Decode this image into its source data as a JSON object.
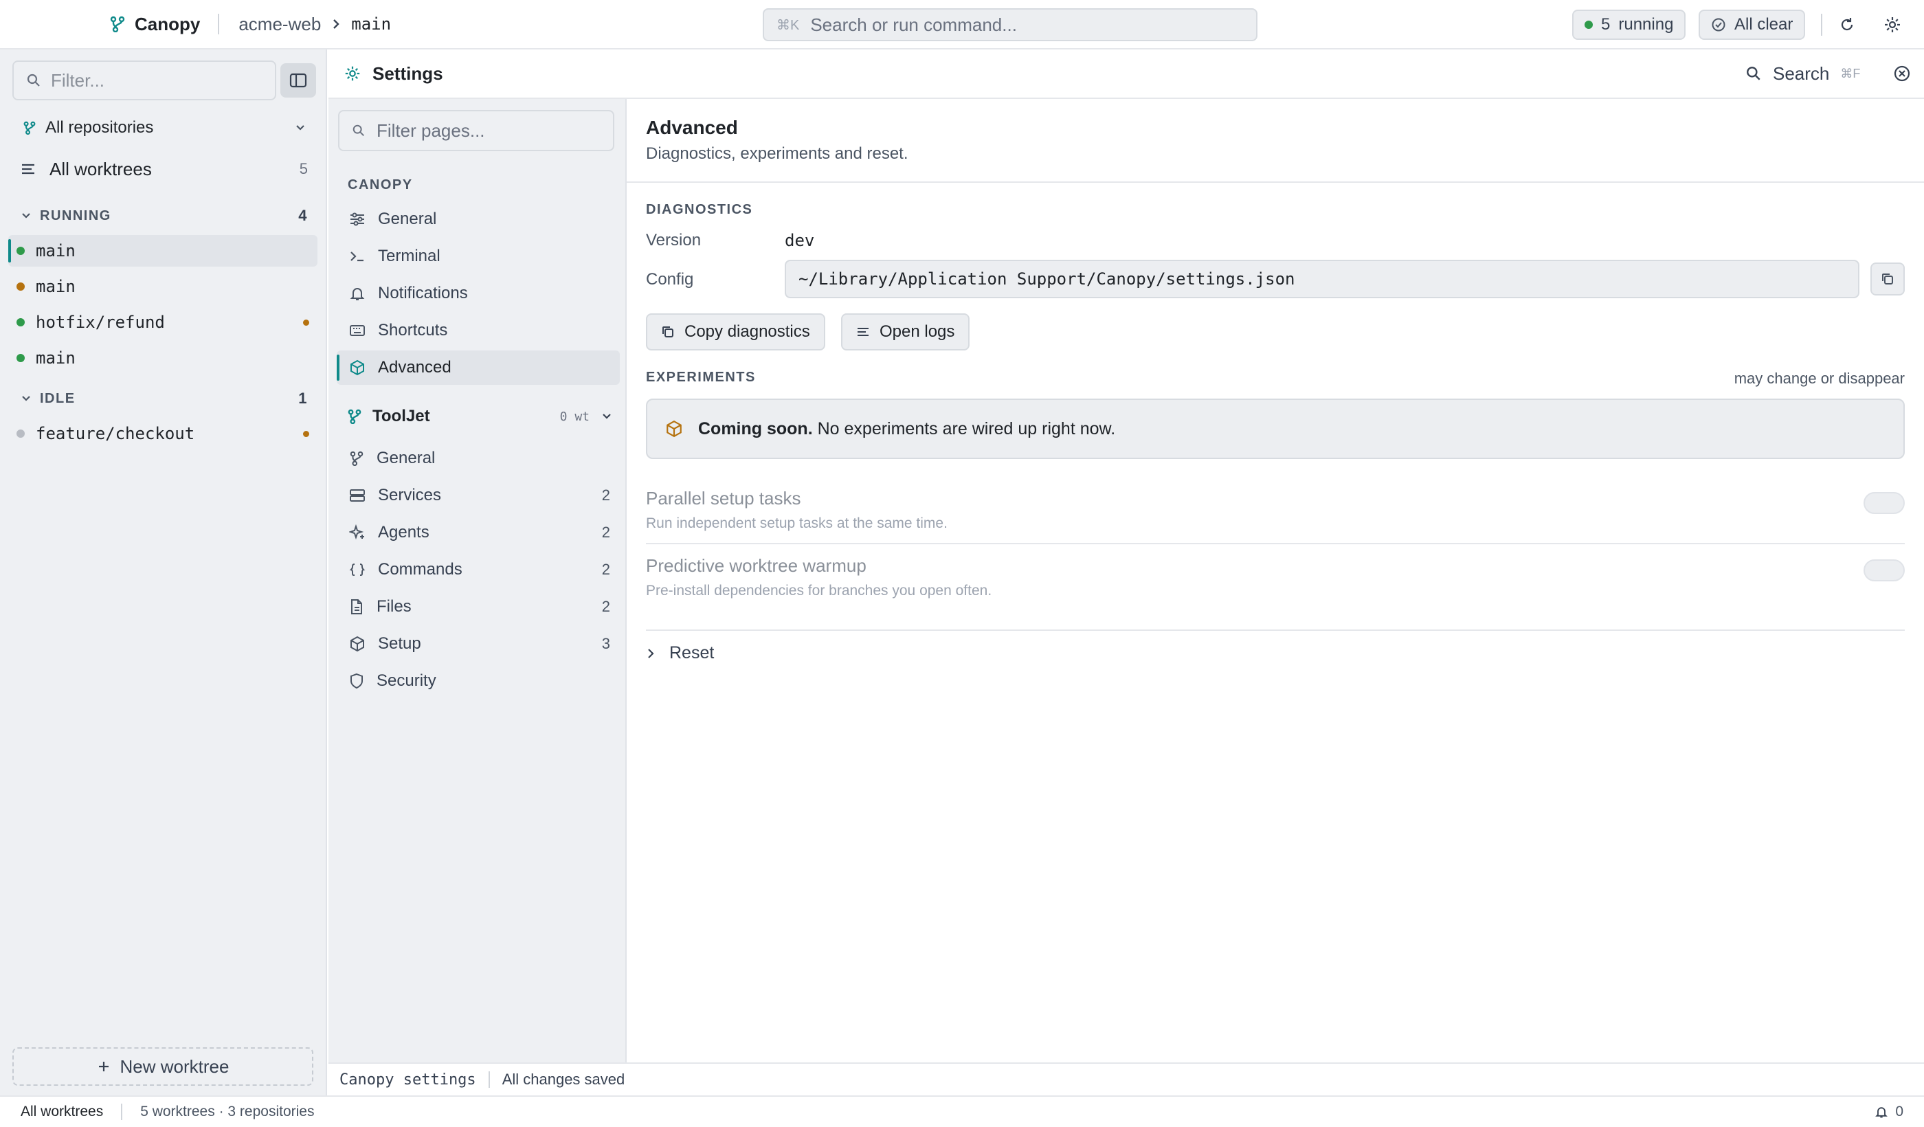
{
  "colors": {
    "accent": "#0f8a8a",
    "running": "#2e9a4a",
    "warning": "#b5720f",
    "idle": "#b8bcc3"
  },
  "topbar": {
    "app_name": "Canopy",
    "repo": "acme-web",
    "branch": "main",
    "command_shortcut": "⌘K",
    "command_placeholder": "Search or run command...",
    "running_count": "5",
    "running_label": "running",
    "status_label": "All clear",
    "icons": [
      "branch-icon",
      "chevron-right-icon",
      "refresh-icon",
      "gear-icon"
    ]
  },
  "sidebar": {
    "filter_placeholder": "Filter...",
    "repo_selector": "All repositories",
    "all_worktrees": {
      "label": "All worktrees",
      "count": "5"
    },
    "groups": [
      {
        "label": "RUNNING",
        "count": "4",
        "items": [
          {
            "name": "main",
            "status": "running",
            "active": true
          },
          {
            "name": "main",
            "status": "warning"
          },
          {
            "name": "hotfix/refund",
            "status": "running",
            "badge": "warning"
          },
          {
            "name": "main",
            "status": "running"
          }
        ]
      },
      {
        "label": "IDLE",
        "count": "1",
        "items": [
          {
            "name": "feature/checkout",
            "status": "idle",
            "badge": "warning"
          }
        ]
      }
    ],
    "new_worktree": "New worktree"
  },
  "settings": {
    "title": "Settings",
    "search_label": "Search",
    "search_shortcut": "⌘F",
    "nav": {
      "filter_placeholder": "Filter pages...",
      "section": "CANOPY",
      "items": [
        {
          "label": "General",
          "icon": "sliders-icon"
        },
        {
          "label": "Terminal",
          "icon": "terminal-icon"
        },
        {
          "label": "Notifications",
          "icon": "bell-icon"
        },
        {
          "label": "Shortcuts",
          "icon": "keyboard-icon"
        },
        {
          "label": "Advanced",
          "icon": "cube-icon",
          "active": true
        }
      ],
      "repo": {
        "name": "ToolJet",
        "wt": "0 wt"
      },
      "repo_items": [
        {
          "label": "General",
          "icon": "branch-icon",
          "count": ""
        },
        {
          "label": "Services",
          "icon": "server-icon",
          "count": "2"
        },
        {
          "label": "Agents",
          "icon": "sparkle-icon",
          "count": "2"
        },
        {
          "label": "Commands",
          "icon": "braces-icon",
          "count": "2"
        },
        {
          "label": "Files",
          "icon": "file-icon",
          "count": "2"
        },
        {
          "label": "Setup",
          "icon": "cube-icon",
          "count": "3"
        },
        {
          "label": "Security",
          "icon": "shield-icon",
          "count": ""
        }
      ]
    },
    "content": {
      "title": "Advanced",
      "subtitle": "Diagnostics, experiments and reset.",
      "diagnostics": {
        "header": "DIAGNOSTICS",
        "version_label": "Version",
        "version_value": "dev",
        "config_label": "Config",
        "config_value": "~/Library/Application Support/Canopy/settings.json",
        "copy_button": "Copy diagnostics",
        "logs_button": "Open logs"
      },
      "experiments": {
        "header": "EXPERIMENTS",
        "note": "may change or disappear",
        "soon_bold": "Coming soon.",
        "soon_text": "No experiments are wired up right now.",
        "items": [
          {
            "title": "Parallel setup tasks",
            "desc": "Run independent setup tasks at the same time.",
            "enabled": false
          },
          {
            "title": "Predictive worktree warmup",
            "desc": "Pre-install dependencies for branches you open often.",
            "enabled": false
          }
        ]
      },
      "reset_label": "Reset"
    },
    "footer": {
      "name": "Canopy settings",
      "status": "All changes saved"
    }
  },
  "statusbar": {
    "scope": "All worktrees",
    "summary": "5 worktrees · 3 repositories",
    "notifications": "0"
  }
}
